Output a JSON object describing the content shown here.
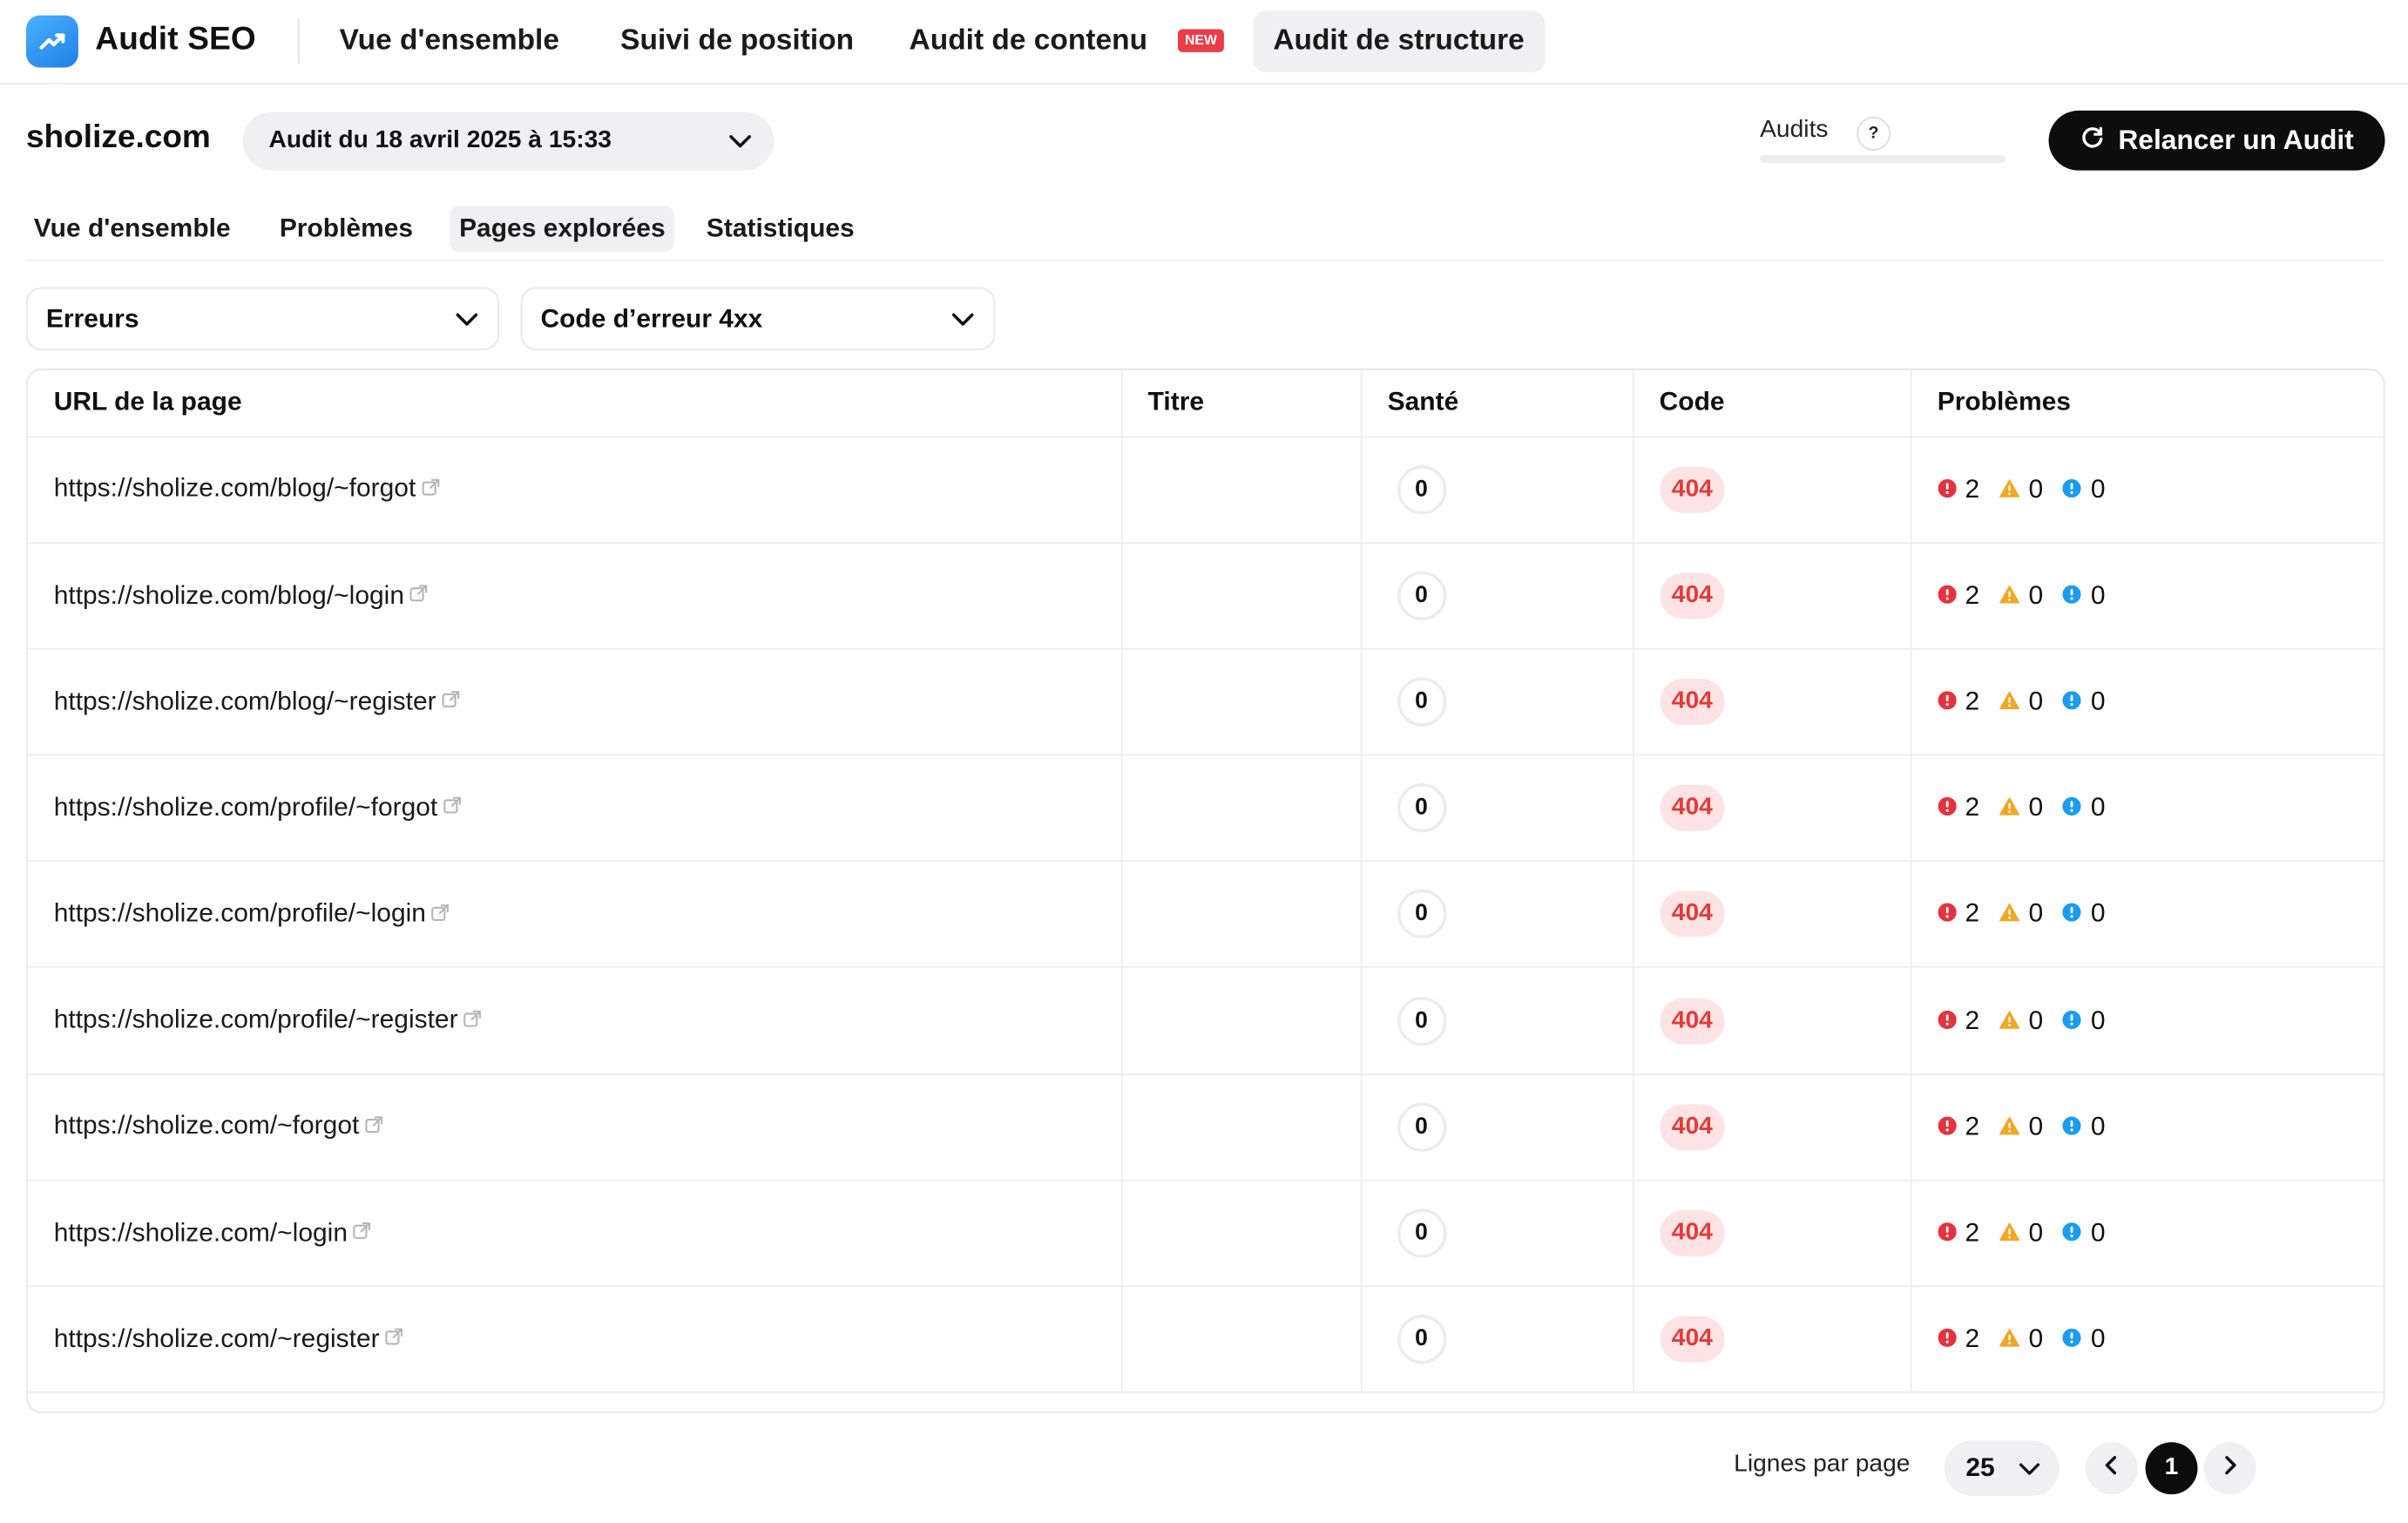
{
  "app": {
    "title": "Audit SEO"
  },
  "nav": {
    "items": [
      {
        "label": "Vue d'ensemble"
      },
      {
        "label": "Suivi de position"
      },
      {
        "label": "Audit de contenu",
        "badge": "NEW"
      },
      {
        "label": "Audit de structure",
        "active": true
      }
    ]
  },
  "header": {
    "domain": "sholize.com",
    "audit_selected": "Audit du 18 avril 2025 à 15:33",
    "audits_label": "Audits",
    "help": "?",
    "relaunch_label": "Relancer un Audit"
  },
  "subtabs": [
    {
      "label": "Vue d'ensemble"
    },
    {
      "label": "Problèmes"
    },
    {
      "label": "Pages explorées",
      "active": true
    },
    {
      "label": "Statistiques"
    }
  ],
  "filters": {
    "type": "Erreurs",
    "code": "Code d’erreur 4xx"
  },
  "table": {
    "headers": [
      "URL de la page",
      "Titre",
      "Santé",
      "Code",
      "Problèmes"
    ],
    "rows": [
      {
        "url": "https://sholize.com/blog/~forgot",
        "title": "",
        "health": "0",
        "code": "404",
        "errors": "2",
        "warnings": "0",
        "notices": "0"
      },
      {
        "url": "https://sholize.com/blog/~login",
        "title": "",
        "health": "0",
        "code": "404",
        "errors": "2",
        "warnings": "0",
        "notices": "0"
      },
      {
        "url": "https://sholize.com/blog/~register",
        "title": "",
        "health": "0",
        "code": "404",
        "errors": "2",
        "warnings": "0",
        "notices": "0"
      },
      {
        "url": "https://sholize.com/profile/~forgot",
        "title": "",
        "health": "0",
        "code": "404",
        "errors": "2",
        "warnings": "0",
        "notices": "0"
      },
      {
        "url": "https://sholize.com/profile/~login",
        "title": "",
        "health": "0",
        "code": "404",
        "errors": "2",
        "warnings": "0",
        "notices": "0"
      },
      {
        "url": "https://sholize.com/profile/~register",
        "title": "",
        "health": "0",
        "code": "404",
        "errors": "2",
        "warnings": "0",
        "notices": "0"
      },
      {
        "url": "https://sholize.com/~forgot",
        "title": "",
        "health": "0",
        "code": "404",
        "errors": "2",
        "warnings": "0",
        "notices": "0"
      },
      {
        "url": "https://sholize.com/~login",
        "title": "",
        "health": "0",
        "code": "404",
        "errors": "2",
        "warnings": "0",
        "notices": "0"
      },
      {
        "url": "https://sholize.com/~register",
        "title": "",
        "health": "0",
        "code": "404",
        "errors": "2",
        "warnings": "0",
        "notices": "0"
      }
    ]
  },
  "pagination": {
    "rows_label": "Lignes par page",
    "rows_per_page": "25",
    "current_page": "1"
  },
  "colors": {
    "accent": "#0d0d0d",
    "error": "#e5323e",
    "warning": "#f4a623",
    "notice": "#1a9cf0",
    "code_bg": "#fde3e3",
    "code_text": "#e23b3b"
  }
}
